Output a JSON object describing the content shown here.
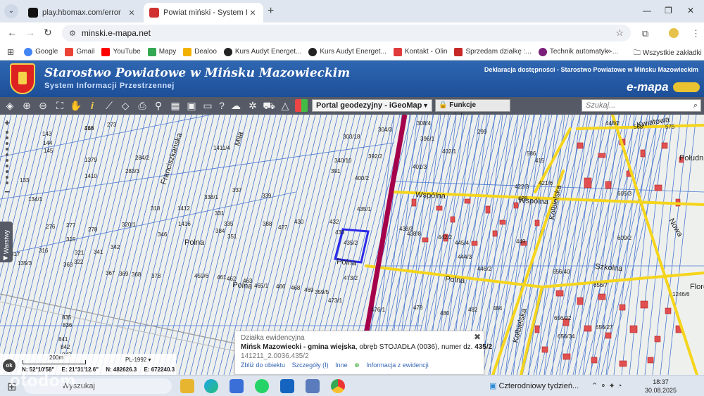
{
  "browser": {
    "tabs": [
      {
        "title": "play.hbomax.com/error",
        "active": false,
        "favicon_color": "#111111"
      },
      {
        "title": "Powiat miński - System Informa",
        "active": true,
        "favicon_color": "#d03030"
      }
    ],
    "url": "minski.e-mapa.net",
    "bookmarks": [
      {
        "label": "Google",
        "color": "#4285f4"
      },
      {
        "label": "Gmail",
        "color": "#ea4335"
      },
      {
        "label": "YouTube",
        "color": "#ff0000"
      },
      {
        "label": "Mapy",
        "color": "#34a853"
      },
      {
        "label": "Dealoo",
        "color": "#f2b200"
      },
      {
        "label": "Kurs Audyt Energet...",
        "color": "#222222"
      },
      {
        "label": "Kurs Audyt Energet...",
        "color": "#222222"
      },
      {
        "label": "Kontakt - Olin",
        "color": "#e03a3a"
      },
      {
        "label": "Sprzedam działkę :...",
        "color": "#c62828"
      },
      {
        "label": "Technik automatyk -...",
        "color": "#7a1f7a"
      }
    ],
    "bookmarks_more": "»",
    "all_bookmarks": "Wszystkie zakładki"
  },
  "header": {
    "title": "Starostwo Powiatowe w Mińsku Mazowieckim",
    "subtitle": "System Informacji Przestrzennej",
    "accessibility": "Deklaracja dostępności - Starostwo Powiatowe w Mińsku Mazowieckim",
    "brand": "e-mapa"
  },
  "toolbar": {
    "portal": "Portal geodezyjny - iGeoMap",
    "special_functions": "Funkcje specjalne",
    "search_placeholder": "Szukaj..."
  },
  "map": {
    "layers_tab": "Warstwy",
    "parcel_labels": [
      "268",
      "273",
      "304/3",
      "308/4",
      "299",
      "303/18",
      "340/10",
      "391",
      "392/2",
      "396/1",
      "402/1",
      "401/3",
      "400/2",
      "435/1",
      "435/2",
      "432",
      "433",
      "473/2",
      "473/1",
      "476/1",
      "478",
      "480",
      "482",
      "484",
      "438/3",
      "438/8",
      "442/2",
      "445/4",
      "444/3",
      "446/2",
      "449",
      "605/3",
      "609/2",
      "656/7",
      "656/40",
      "656/22",
      "656/27",
      "656/34",
      "1246/6",
      "384",
      "388",
      "427",
      "430",
      "465/1",
      "466",
      "468",
      "469",
      "359/5",
      "339",
      "337",
      "338/1",
      "331",
      "335",
      "351",
      "346",
      "342",
      "341",
      "322",
      "320/1",
      "318",
      "317",
      "316",
      "315",
      "321",
      "363",
      "367",
      "368",
      "369",
      "378",
      "459/6",
      "461",
      "462",
      "463",
      "1412",
      "1416",
      "1411/4",
      "1379",
      "1410",
      "284/2",
      "283/3",
      "276",
      "277",
      "278",
      "143",
      "144",
      "145",
      "133",
      "134/1",
      "135/3",
      "835",
      "836",
      "841",
      "842",
      "843",
      "415",
      "421/6",
      "422/3",
      "428",
      "448/2",
      "568",
      "575",
      "586",
      "416"
    ],
    "streets": [
      "Polna",
      "Polna",
      "Polna",
      "Wspólna",
      "Wspólna",
      "Kolbielska",
      "Kolbielska",
      "Szkolna",
      "Kwiatowa",
      "Nowa",
      "Franciszkańska",
      "Miła",
      "Polna",
      "Flore",
      "Południow"
    ],
    "popup": {
      "header": "Działka ewidencyjna",
      "place": "Mińsk Mazowiecki - gmina wiejska",
      "obreb_text": ", obręb STOJADŁA (0036), numer dz.",
      "parcel": "435/2",
      "parcel_id": "141211_2.0036.435/2",
      "links": [
        "Zbliż do obiektu",
        "Szczegóły (I)",
        "Inne",
        "Informacja z ewidencji"
      ],
      "close": "✖"
    },
    "scale": {
      "label": "200m",
      "crs": "PL-1992",
      "ok": "ok",
      "n_geo": "N: 52°10'58\"",
      "e_geo": "E: 21°31'12.6\"",
      "n_proj": "N: 482626.3",
      "e_proj": "E: 672240.3"
    }
  },
  "taskbar": {
    "search_text": "Wyszukaj",
    "watermark": "otodom",
    "weather": "Czterodniowy tydzień...",
    "time": "18:37",
    "date": "30.08.2025"
  },
  "colors": {
    "header_blue": "#1d4f98",
    "road_yellow": "#f5d51c",
    "railway": "#a5004a",
    "selection": "#2a2ae8",
    "parcel_line": "#4a78d0",
    "building": "#e05050"
  }
}
